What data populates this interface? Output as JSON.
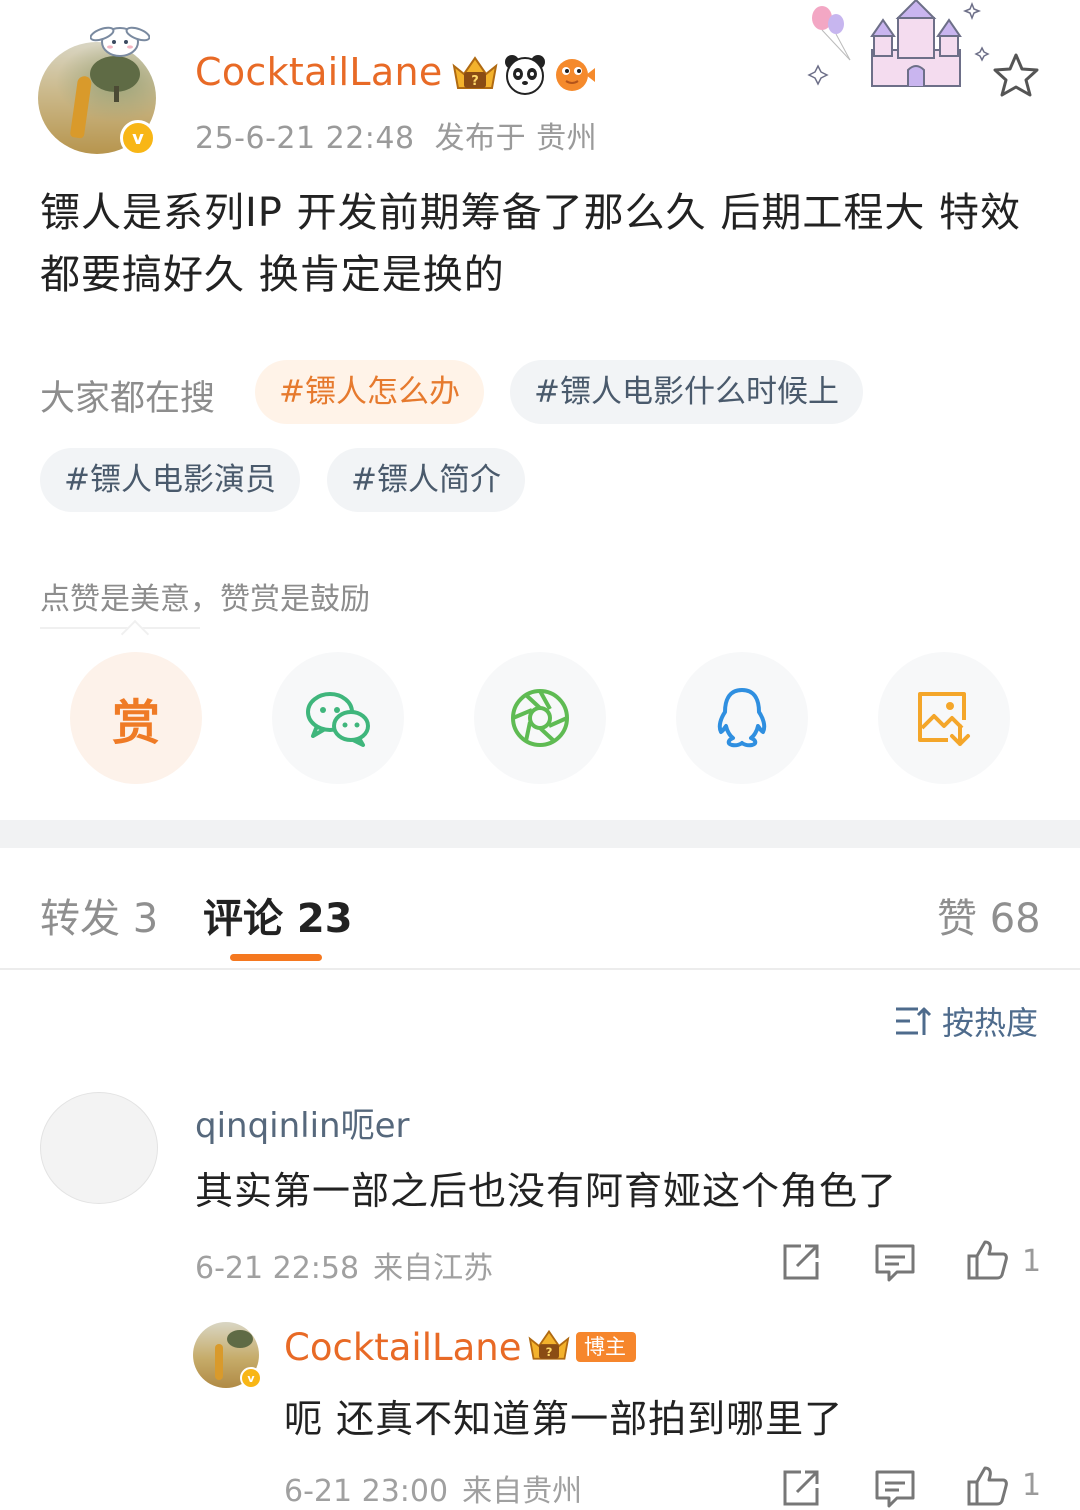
{
  "post": {
    "author": "CocktailLane",
    "verified_mark": "v",
    "timestamp": "25-6-21 22:48",
    "location": "发布于 贵州",
    "text": "镖人是系列IP 开发前期筹备了那么久 后期工程大 特效都要搞好久 换肯定是换的",
    "badges": [
      "crown-badge-icon",
      "panda-icon",
      "pufferfish-icon"
    ]
  },
  "trending": {
    "label": "大家都在搜",
    "tags": [
      "#镖人怎么办",
      "#镖人电影什么时候上",
      "#镖人电影演员",
      "#镖人简介"
    ]
  },
  "reward": {
    "tip": "点赞是美意，赞赏是鼓励",
    "reward_char": "赏"
  },
  "share_targets": [
    "reward-icon",
    "wechat-icon",
    "moments-icon",
    "qq-icon",
    "save-image-icon"
  ],
  "tabs": {
    "repost": "转发 3",
    "comments": "评论 23",
    "likes": "赞 68"
  },
  "sort": {
    "label": "按热度"
  },
  "comments": [
    {
      "user": "qinqinlin呃er",
      "text": "其实第一部之后也没有阿育娅这个角色了",
      "time": "6-21 22:58",
      "location": "来自江苏",
      "likes": "1"
    }
  ],
  "reply": {
    "user": "CocktailLane",
    "badge": "博主",
    "text": "呃 还真不知道第一部拍到哪里了",
    "time": "6-21 23:00",
    "location": "来自贵州",
    "likes": "1"
  },
  "colors": {
    "accent": "#e86a26",
    "tab_underline": "#f5781f",
    "link_blue": "#4e6b8c",
    "verified": "#f8b616"
  }
}
